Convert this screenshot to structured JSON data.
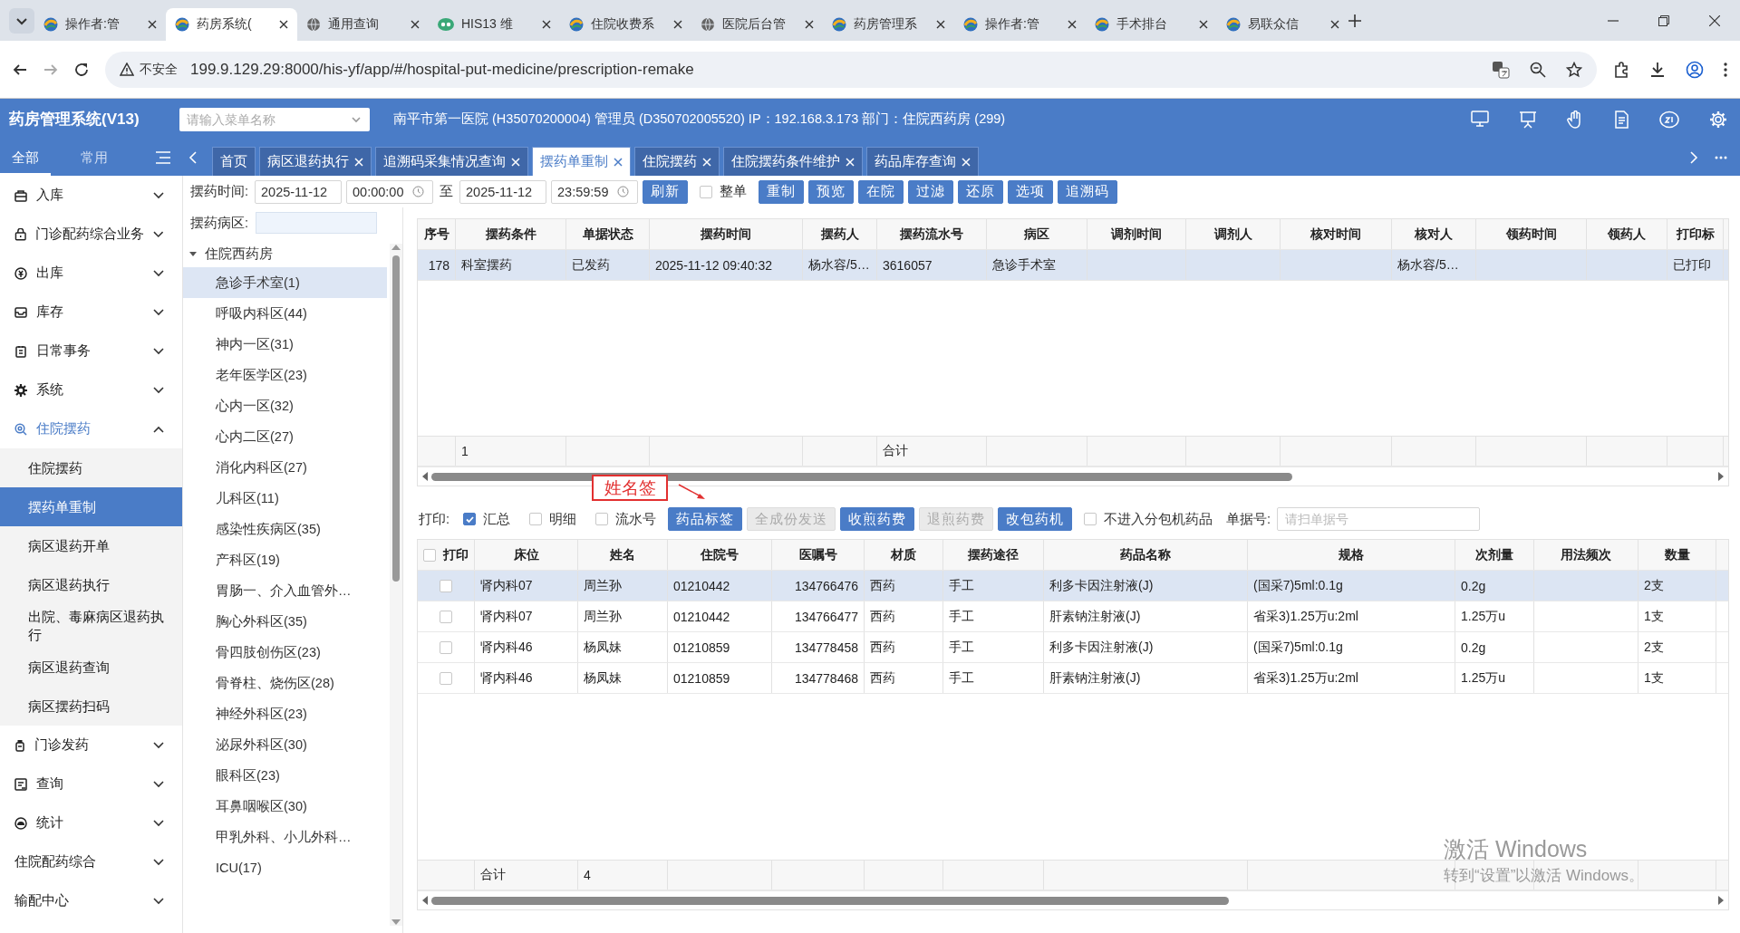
{
  "browser": {
    "tabs": [
      {
        "title": "操作者:管",
        "selected": false
      },
      {
        "title": "药房系统(",
        "selected": true
      },
      {
        "title": "通用查询",
        "selected": false
      },
      {
        "title": "HIS13 维",
        "selected": false
      },
      {
        "title": "住院收费系",
        "selected": false
      },
      {
        "title": "医院后台管",
        "selected": false
      },
      {
        "title": "药房管理系",
        "selected": false
      },
      {
        "title": "操作者:管",
        "selected": false
      },
      {
        "title": "手术排台",
        "selected": false
      },
      {
        "title": "易联众信",
        "selected": false
      }
    ],
    "address": {
      "security": "不安全",
      "url": "199.9.129.29:8000/his-yf/app/#/hospital-put-medicine/prescription-remake"
    }
  },
  "app": {
    "title": "药房管理系统(V13)",
    "menu_search": {
      "placeholder": "请输入菜单名称"
    },
    "info": "南平市第一医院 (H35070200004) 管理员 (D350702005520) IP：192.168.3.173 部门：住院西药房 (299)"
  },
  "nav_tabs": [
    {
      "label": "全部",
      "selected": true
    },
    {
      "label": "常用",
      "selected": false
    }
  ],
  "sidebar": {
    "items": [
      {
        "label": "入库",
        "expanded": false
      },
      {
        "label": "门诊配药综合业务",
        "expanded": false
      },
      {
        "label": "出库",
        "expanded": false
      },
      {
        "label": "库存",
        "expanded": false
      },
      {
        "label": "日常事务",
        "expanded": false
      },
      {
        "label": "系统",
        "expanded": false
      },
      {
        "label": "住院摆药",
        "expanded": true,
        "children": [
          {
            "label": "住院摆药",
            "selected": false
          },
          {
            "label": "摆药单重制",
            "selected": true
          },
          {
            "label": "病区退药开单",
            "selected": false
          },
          {
            "label": "病区退药执行",
            "selected": false
          },
          {
            "label": "出院、毒麻病区退药执行",
            "selected": false
          },
          {
            "label": "病区退药查询",
            "selected": false
          },
          {
            "label": "病区摆药扫码",
            "selected": false
          }
        ]
      },
      {
        "label": "门诊发药",
        "expanded": false
      },
      {
        "label": "查询",
        "expanded": false
      },
      {
        "label": "统计",
        "expanded": false
      },
      {
        "label": "住院配药综合",
        "expanded": false
      },
      {
        "label": "输配中心",
        "expanded": false
      }
    ]
  },
  "page_tabs": [
    {
      "label": "首页",
      "selected": false,
      "closable": false
    },
    {
      "label": "病区退药执行",
      "selected": false,
      "closable": true
    },
    {
      "label": "追溯码采集情况查询",
      "selected": false,
      "closable": true
    },
    {
      "label": "摆药单重制",
      "selected": true,
      "closable": true
    },
    {
      "label": "住院摆药",
      "selected": false,
      "closable": true
    },
    {
      "label": "住院摆药条件维护",
      "selected": false,
      "closable": true
    },
    {
      "label": "药品库存查询",
      "selected": false,
      "closable": true
    }
  ],
  "filter_bar": [
    {
      "kind": "label",
      "text": "摆药时间:"
    },
    {
      "kind": "date",
      "value": "2025-11-12"
    },
    {
      "kind": "time",
      "value": "00:00:00"
    },
    {
      "kind": "label",
      "text": "至"
    },
    {
      "kind": "date",
      "value": "2025-11-12"
    },
    {
      "kind": "time",
      "value": "23:59:59"
    },
    {
      "kind": "button",
      "label": "刷新"
    },
    {
      "kind": "checkbox",
      "label": "整单",
      "checked": false
    },
    {
      "kind": "button",
      "label": "重制"
    },
    {
      "kind": "button",
      "label": "预览"
    },
    {
      "kind": "button",
      "label": "在院"
    },
    {
      "kind": "button",
      "label": "过滤"
    },
    {
      "kind": "button",
      "label": "还原"
    },
    {
      "kind": "button",
      "label": "选项"
    },
    {
      "kind": "button",
      "label": "追溯码"
    }
  ],
  "ward_panel": {
    "label": "摆药病区:",
    "tree": {
      "label": "住院西药房",
      "expanded": true,
      "children": [
        {
          "label": "急诊手术室(1)",
          "selected": true
        },
        {
          "label": "呼吸内科区(44)",
          "selected": false
        },
        {
          "label": "神内一区(31)",
          "selected": false
        },
        {
          "label": "老年医学区(23)",
          "selected": false
        },
        {
          "label": "心内一区(32)",
          "selected": false
        },
        {
          "label": "心内二区(27)",
          "selected": false
        },
        {
          "label": "消化内科区(27)",
          "selected": false
        },
        {
          "label": "儿科区(11)",
          "selected": false
        },
        {
          "label": "感染性疾病区(35)",
          "selected": false
        },
        {
          "label": "产科区(19)",
          "selected": false
        },
        {
          "label": "胃肠一、介入血管外…",
          "selected": false
        },
        {
          "label": "胸心外科区(35)",
          "selected": false
        },
        {
          "label": "骨四肢创伤区(23)",
          "selected": false
        },
        {
          "label": "骨脊柱、烧伤区(28)",
          "selected": false
        },
        {
          "label": "神经外科区(23)",
          "selected": false
        },
        {
          "label": "泌尿外科区(30)",
          "selected": false
        },
        {
          "label": "眼科区(23)",
          "selected": false
        },
        {
          "label": "耳鼻咽喉区(30)",
          "selected": false
        },
        {
          "label": "甲乳外科、小儿外科…",
          "selected": false
        },
        {
          "label": "ICU(17)",
          "selected": false
        }
      ]
    }
  },
  "top_table": {
    "columns": [
      {
        "label": "序号"
      },
      {
        "label": "摆药条件",
        "total": "1"
      },
      {
        "label": "单据状态"
      },
      {
        "label": "摆药时间"
      },
      {
        "label": "摆药人"
      },
      {
        "label": "摆药流水号",
        "total": "合计"
      },
      {
        "label": "病区"
      },
      {
        "label": "调剂时间"
      },
      {
        "label": "调剂人"
      },
      {
        "label": "核对时间"
      },
      {
        "label": "核对人"
      },
      {
        "label": "领药时间"
      },
      {
        "label": "领药人"
      },
      {
        "label": "打印标"
      }
    ],
    "rows": [
      {
        "selected": true,
        "cells": [
          "178",
          "科室摆药",
          "已发药",
          "2025-11-12 09:40:32",
          "杨水容/5…",
          "3616057",
          "急诊手术室",
          null,
          null,
          null,
          "杨水容/5…",
          null,
          null,
          "已打印"
        ]
      }
    ]
  },
  "print_bar": [
    {
      "kind": "label",
      "text": "打印:"
    },
    {
      "kind": "checkbox",
      "label": "汇总",
      "checked": true
    },
    {
      "kind": "checkbox",
      "label": "明细",
      "checked": false
    },
    {
      "kind": "checkbox",
      "label": "流水号",
      "checked": false
    },
    {
      "kind": "button",
      "label": "药品标签",
      "disabled": false
    },
    {
      "kind": "button",
      "label": "全成份发送",
      "disabled": true
    },
    {
      "kind": "button",
      "label": "收煎药费",
      "disabled": false
    },
    {
      "kind": "button",
      "label": "退煎药费",
      "disabled": true
    },
    {
      "kind": "button",
      "label": "改包药机",
      "disabled": false
    },
    {
      "kind": "checkbox",
      "label": "不进入分包机药品",
      "checked": false
    },
    {
      "kind": "label",
      "text": "单据号:"
    },
    {
      "kind": "input",
      "placeholder": "请扫单据号"
    }
  ],
  "annotation": {
    "text": "姓名签"
  },
  "bottom_table": {
    "columns": [
      {
        "label": "打印",
        "checked": false
      },
      {
        "label": "床位",
        "total": "合计"
      },
      {
        "label": "姓名",
        "total": "4"
      },
      {
        "label": "住院号"
      },
      {
        "label": "医嘱号"
      },
      {
        "label": "材质"
      },
      {
        "label": "摆药途径"
      },
      {
        "label": "药品名称"
      },
      {
        "label": "规格"
      },
      {
        "label": "次剂量"
      },
      {
        "label": "用法频次"
      },
      {
        "label": "数量"
      }
    ],
    "rows": [
      {
        "selected": true,
        "checked": false,
        "cells": [
          null,
          "肾内科07",
          "周兰孙",
          "01210442",
          "134766476",
          "西药",
          "手工",
          "利多卡因注射液(J)",
          "(国采7)5ml:0.1g",
          "0.2g",
          null,
          "2支"
        ]
      },
      {
        "selected": false,
        "checked": false,
        "cells": [
          null,
          "肾内科07",
          "周兰孙",
          "01210442",
          "134766477",
          "西药",
          "手工",
          "肝素钠注射液(J)",
          "省采3)1.25万u:2ml",
          "1.25万u",
          null,
          "1支"
        ]
      },
      {
        "selected": false,
        "checked": false,
        "cells": [
          null,
          "肾内科46",
          "杨凤妹",
          "01210859",
          "134778458",
          "西药",
          "手工",
          "利多卡因注射液(J)",
          "(国采7)5ml:0.1g",
          "0.2g",
          null,
          "2支"
        ]
      },
      {
        "selected": false,
        "checked": false,
        "cells": [
          null,
          "肾内科46",
          "杨凤妹",
          "01210859",
          "134778468",
          "西药",
          "手工",
          "肝素钠注射液(J)",
          "省采3)1.25万u:2ml",
          "1.25万u",
          null,
          "1支"
        ]
      }
    ]
  },
  "os_notice": {
    "title": "激活 Windows",
    "text": "转到“设置”以激活 Windows。"
  }
}
